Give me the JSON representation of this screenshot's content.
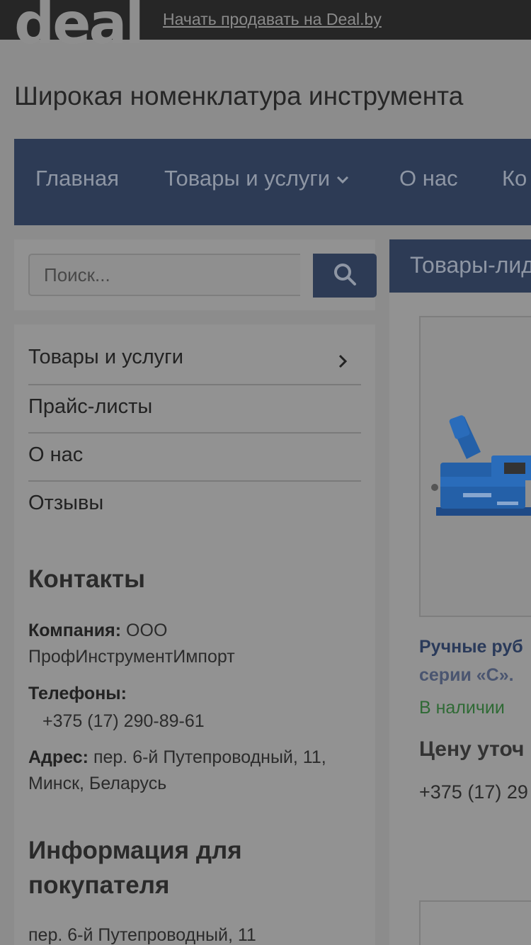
{
  "topbar": {
    "logo": "deal",
    "sell_link": "Начать продавать на Deal.by"
  },
  "store": {
    "title": "Широкая номенклатура инструмента"
  },
  "nav": {
    "items": [
      "Главная",
      "Товары и услуги",
      "О нас",
      "Ко"
    ],
    "dropdown_icon": "chevron-down-icon"
  },
  "search": {
    "placeholder": "Поиск...",
    "button_icon": "search-icon"
  },
  "sidebar": {
    "menu": [
      {
        "label": "Товары и услуги",
        "icon": "chevron-right-icon"
      },
      {
        "label": "Прайс-листы"
      },
      {
        "label": "О нас"
      },
      {
        "label": "Отзывы"
      }
    ],
    "contacts": {
      "heading": "Контакты",
      "company_label": "Компания:",
      "company_value": "ООО ПрофИнструментИмпорт",
      "phones_label": "Телефоны:",
      "phone": "+375 (17) 290-89-61",
      "address_label": "Адрес:",
      "address_value": "пер. 6-й Путепроводный, 11, Минск, Беларусь"
    },
    "info": {
      "heading": "Информация для покупателя",
      "address": "пер. 6-й Путепроводный, 11"
    }
  },
  "main": {
    "heading": "Товары-лид",
    "product": {
      "name_line1": "Ручные руб",
      "name_line2": "серии «С».",
      "stock": "В наличии",
      "price": "Цену уточ",
      "phone": "+375 (17) 29"
    }
  },
  "colors": {
    "brand_dark": "#2d3b55",
    "topbar": "#262626",
    "in_stock": "#2f6a35",
    "overlay_bg": "#8c8c8c"
  }
}
